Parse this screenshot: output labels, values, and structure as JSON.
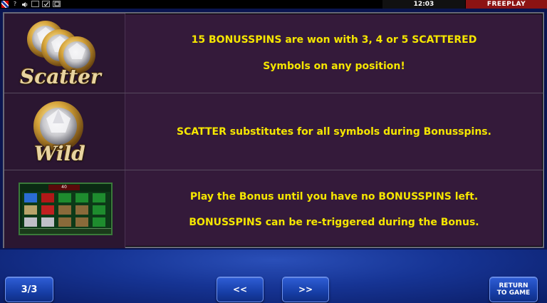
{
  "status_bar": {
    "icons": [
      "flag-icon",
      "help-icon",
      "sound-icon",
      "window-icon",
      "settings-icon",
      "fullscreen-icon"
    ],
    "help_label": "?",
    "clock": "12:03",
    "mode": "FREEPLAY"
  },
  "paytable": {
    "rows": [
      {
        "symbol": "Scatter",
        "lines": [
          "15 BONUSSPINS are won with 3, 4 or 5 SCATTERED",
          "Symbols on any position!"
        ]
      },
      {
        "symbol": "Wild",
        "lines": [
          "SCATTER substitutes for all symbols during Bonusspins."
        ]
      },
      {
        "symbol": "",
        "preview_counter": "40",
        "lines": [
          "Play the Bonus until you have no BONUSSPINS left.",
          "BONUSSPINS can be re-triggered during the Bonus."
        ]
      }
    ]
  },
  "controls": {
    "page": "3/3",
    "prev": "<<",
    "next": ">>",
    "return_line1": "RETURN",
    "return_line2": "TO GAME"
  },
  "colors": {
    "text_yellow": "#f5e600",
    "panel": "#341a3a",
    "button_blue": "#1f4bbd",
    "freeplay_red": "#8c1313"
  }
}
